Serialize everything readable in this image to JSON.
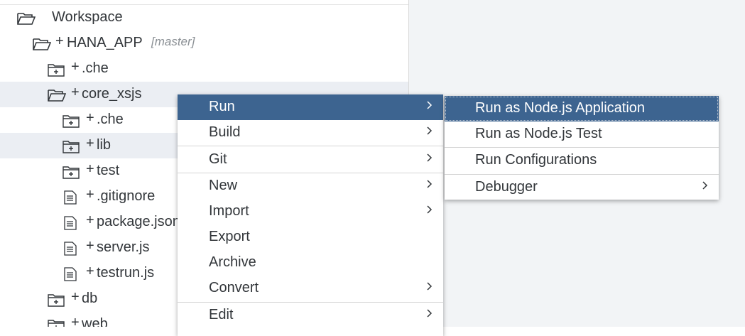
{
  "tree": {
    "workspace_label": "Workspace",
    "items": [
      {
        "plus": "+",
        "label": "HANA_APP",
        "branch": "[master]"
      },
      {
        "plus": "+",
        "label": ".che"
      },
      {
        "plus": "+",
        "label": "core_xsjs"
      },
      {
        "plus": "+",
        "label": ".che"
      },
      {
        "plus": "+",
        "label": "lib"
      },
      {
        "plus": "+",
        "label": "test"
      },
      {
        "plus": "+",
        "label": ".gitignore"
      },
      {
        "plus": "+",
        "label": "package.json"
      },
      {
        "plus": "+",
        "label": "server.js"
      },
      {
        "plus": "+",
        "label": "testrun.js"
      },
      {
        "plus": "+",
        "label": "db"
      },
      {
        "plus": "+",
        "label": "web"
      }
    ]
  },
  "context_menu": {
    "items": [
      "Run",
      "Build",
      "Git",
      "New",
      "Import",
      "Export",
      "Archive",
      "Convert",
      "Edit"
    ]
  },
  "run_submenu": {
    "items": [
      "Run as Node.js Application",
      "Run as Node.js Test",
      "Run Configurations",
      "Debugger"
    ]
  },
  "colors": {
    "accent": "#3d6490",
    "highlight_row": "#ebeef3",
    "right_background": "#f2f4f6",
    "text": "#32363a",
    "muted": "#8a8f94"
  }
}
